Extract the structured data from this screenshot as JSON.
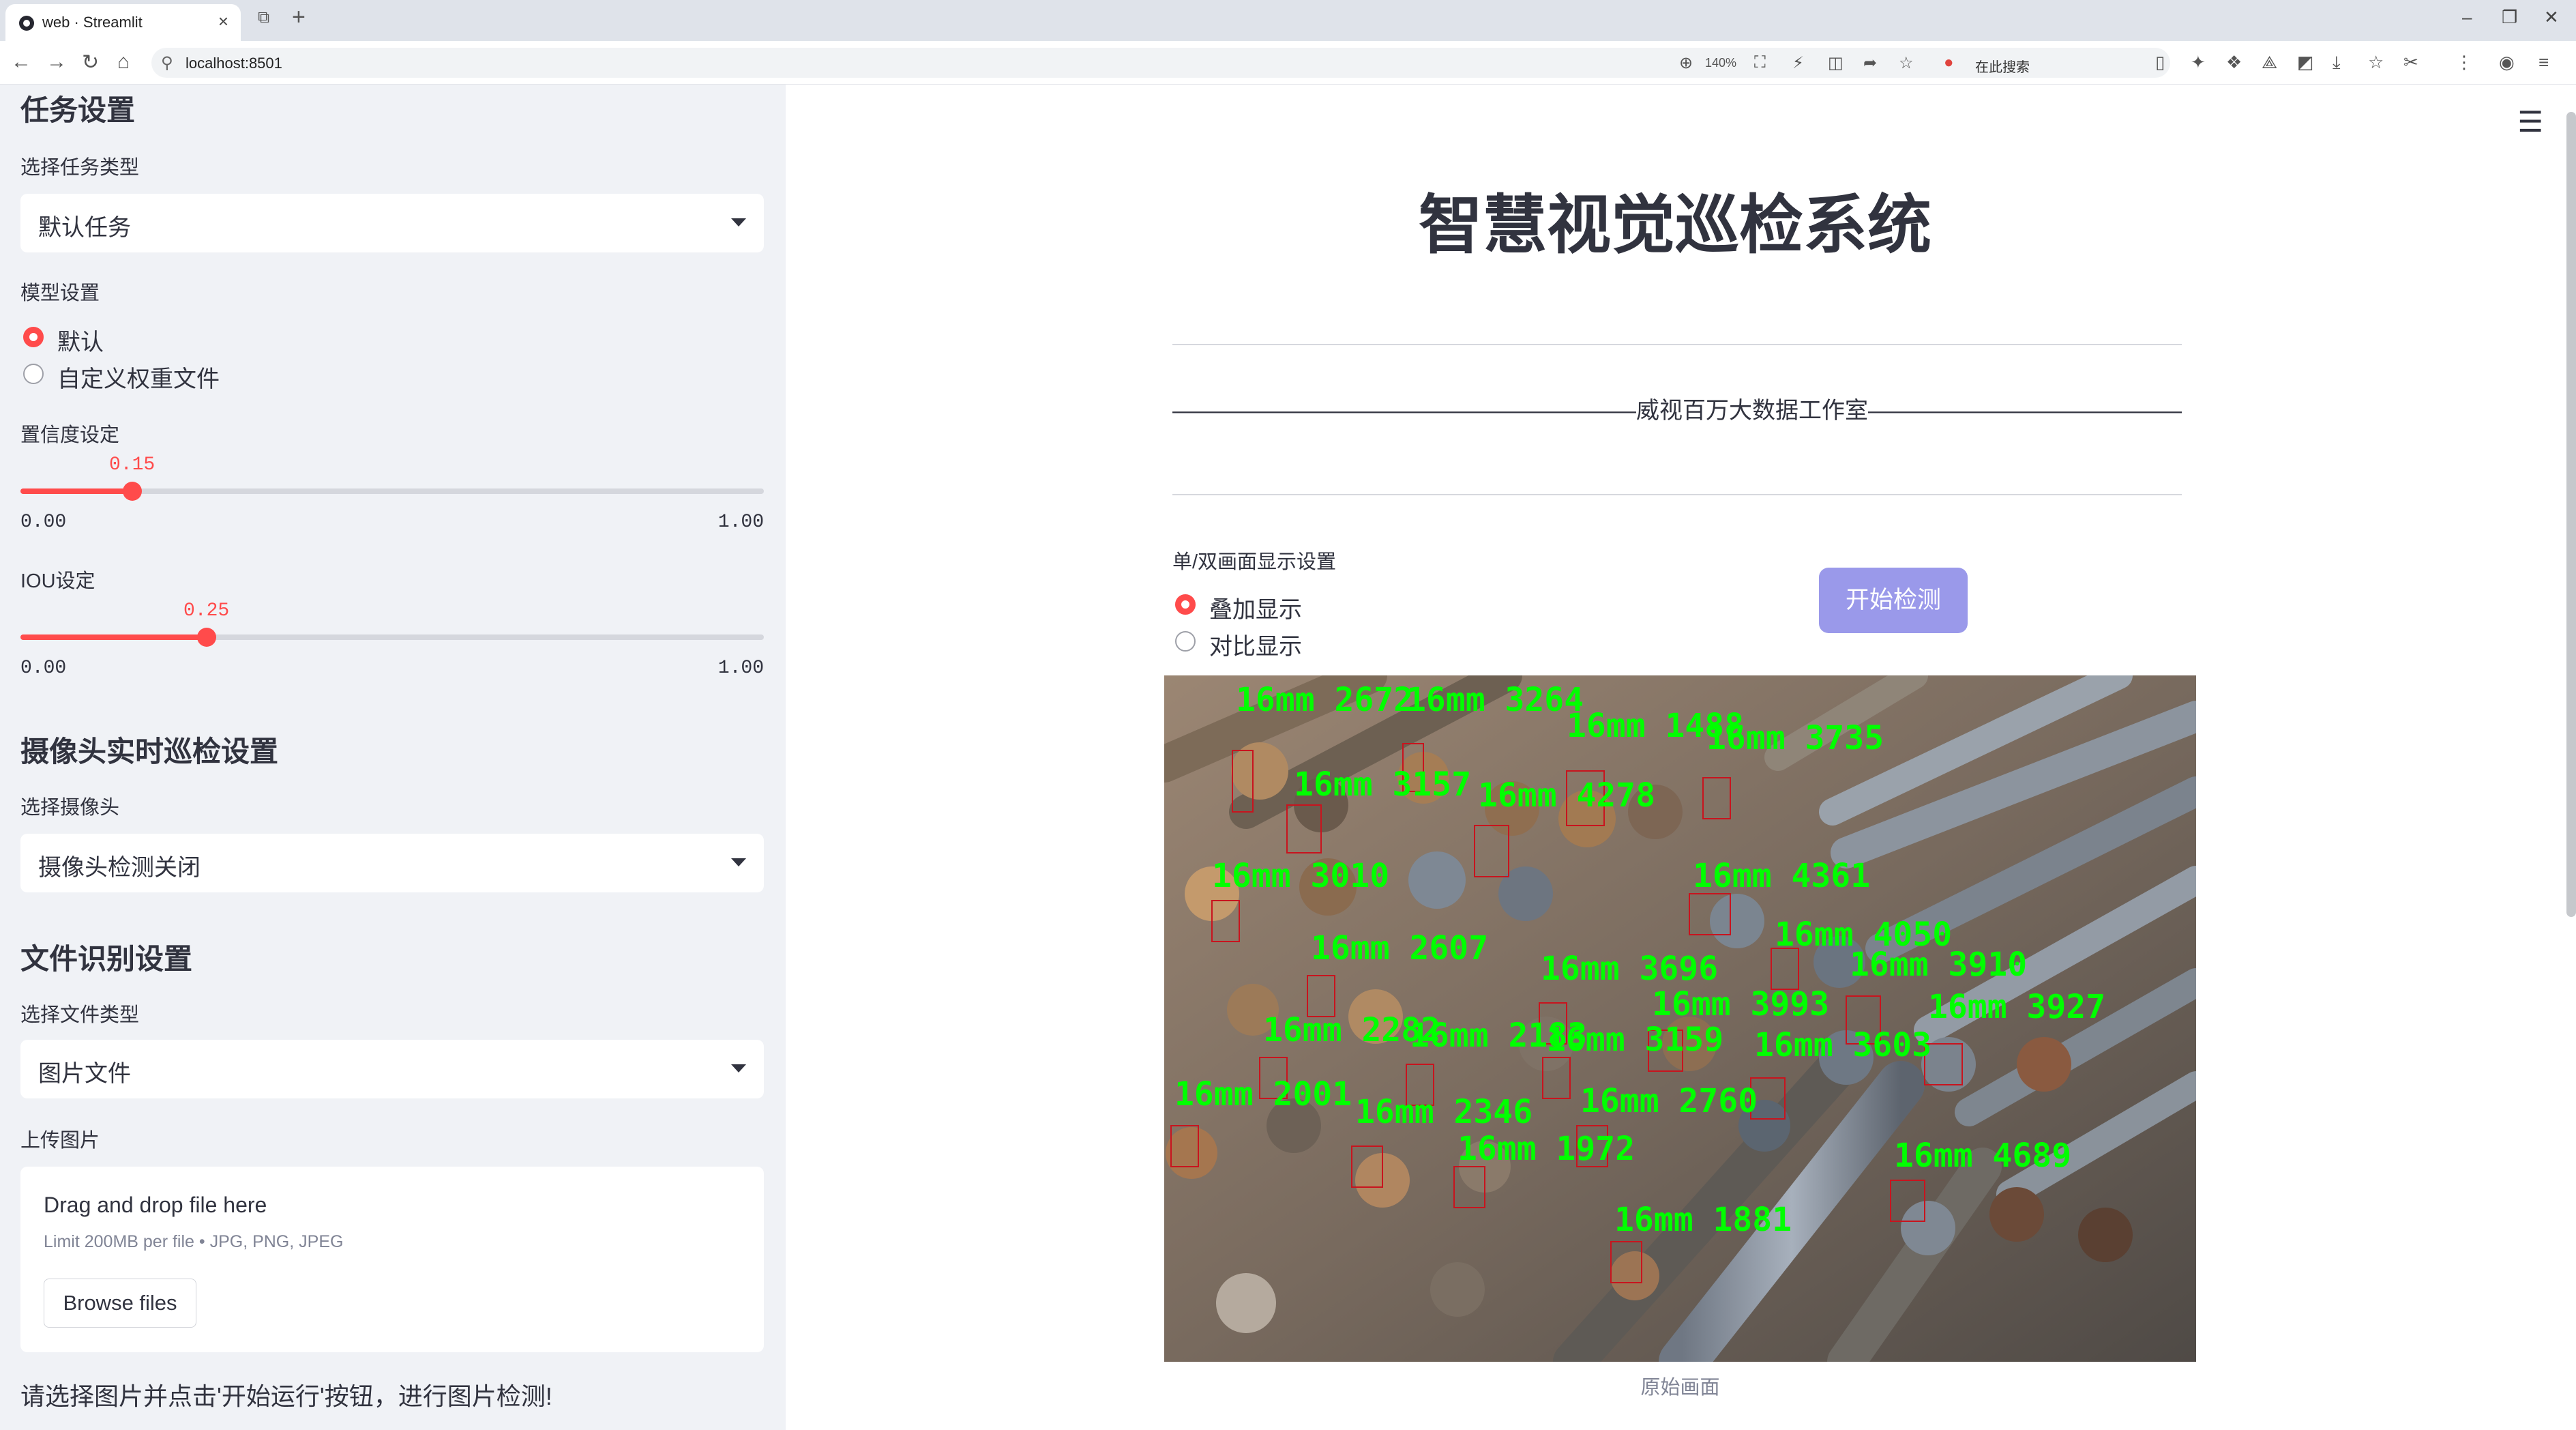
{
  "browser": {
    "tab_title": "web · Streamlit",
    "url": "localhost:8501",
    "zoom": "140%",
    "search_placeholder": "在此搜索"
  },
  "sidebar": {
    "task_section": "任务设置",
    "task_type_label": "选择任务类型",
    "task_type_value": "默认任务",
    "model_label": "模型设置",
    "model_options": [
      "默认",
      "自定义权重文件"
    ],
    "model_selected": 0,
    "confidence_label": "置信度设定",
    "confidence": {
      "value": "0.15",
      "min": "0.00",
      "max": "1.00",
      "fraction": 0.15
    },
    "iou_label": "IOU设定",
    "iou": {
      "value": "0.25",
      "min": "0.00",
      "max": "1.00",
      "fraction": 0.25
    },
    "camera_section": "摄像头实时巡检设置",
    "camera_label": "选择摄像头",
    "camera_value": "摄像头检测关闭",
    "file_section": "文件识别设置",
    "file_type_label": "选择文件类型",
    "file_type_value": "图片文件",
    "upload_label": "上传图片",
    "dropzone_title": "Drag and drop file here",
    "dropzone_limit": "Limit 200MB per file • JPG, PNG, JPEG",
    "browse_label": "Browse files",
    "hint": "请选择图片并点击'开始运行'按钮，进行图片检测!"
  },
  "main": {
    "title": "智慧视觉巡检系统",
    "studio_line": "————————————————————威视百万大数据工作室—————————————————————",
    "display_label": "单/双画面显示设置",
    "display_options": [
      "叠加显示",
      "对比显示"
    ],
    "display_selected": 0,
    "start_button": "开始检测",
    "caption": "原始画面"
  },
  "detections": [
    "16mm 2672",
    "16mm 3264",
    "16mm 1488",
    "16mm 3735",
    "16mm 3157",
    "16mm 4278",
    "16mm 3010",
    "16mm 4361",
    "16mm 4050",
    "16mm 2607",
    "16mm 3696",
    "16mm 3910",
    "16mm 3993",
    "16mm 3927",
    "16mm 2282",
    "16mm 2183",
    "16mm 3159",
    "16mm 3603",
    "16mm 2001",
    "16mm 2760",
    "16mm 2346",
    "16mm 1972",
    "16mm 4689",
    "16mm 1881"
  ],
  "colors": {
    "accent": "#ff4b4b",
    "button": "#9a99ea",
    "sidebar_bg": "#f0f2f6",
    "detection_text": "#00ff00",
    "detection_box": "#c8141e"
  }
}
